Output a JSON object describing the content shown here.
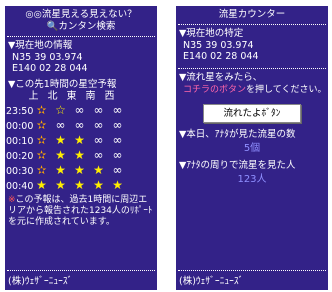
{
  "left": {
    "title_line1": "◎◎流星見える見えない？",
    "title_line2": "🔍カンタン検索",
    "location_header": "▼現在地の情報",
    "lat": "N35 39 03.974",
    "lon": "E140 02 28 044",
    "forecast_header": "▼この先1時間の星空予報",
    "directions": [
      "上",
      "北",
      "東",
      "南",
      "西"
    ],
    "rows": [
      {
        "time": "23:50",
        "cells": [
          "sun-star",
          "star-y",
          "cloud",
          "cloud",
          "cloud"
        ]
      },
      {
        "time": "00:00",
        "cells": [
          "sun-star",
          "cloud",
          "cloud",
          "cloud",
          "cloud"
        ]
      },
      {
        "time": "00:10",
        "cells": [
          "sun-star",
          "star",
          "star",
          "cloud",
          "cloud"
        ]
      },
      {
        "time": "00:20",
        "cells": [
          "sun-star",
          "star",
          "star",
          "cloud",
          "cloud"
        ]
      },
      {
        "time": "00:30",
        "cells": [
          "sun-star",
          "star",
          "star",
          "star",
          "cloud"
        ]
      },
      {
        "time": "00:40",
        "cells": [
          "star",
          "star",
          "star",
          "star",
          "star"
        ]
      }
    ],
    "footnote_mark": "※",
    "footnote": "この予報は、過去1時間に周辺エリアから報告された1234人のﾘﾎﾟｰﾄを元に作成されています。",
    "footer": "(株)ｳｪｻﾞｰﾆｭｰｽﾞ"
  },
  "right": {
    "title": "流星カウンター",
    "location_header": "▼現在地の特定",
    "lat": "N35 39 03.974",
    "lon": "E140 02 28 044",
    "prompt_header": "▼流れ星をみたら、",
    "prompt_pink": "コチラのボタン",
    "prompt_rest": "を押してください。",
    "button_label": "流れたよﾎﾞﾀﾝ",
    "today_header": "▼本日、ｱﾅﾀが見た流星の数",
    "today_count": "5個",
    "around_header": "▼ｱﾅﾀの周りで流星を見た人",
    "around_count": "123人",
    "footer": "(株)ｳｪｻﾞｰﾆｭｰｽﾞ"
  },
  "colors": {
    "panel": "#332288",
    "star": "#ffee00",
    "accent_pink": "#ff66aa",
    "count": "#8f8fff"
  }
}
